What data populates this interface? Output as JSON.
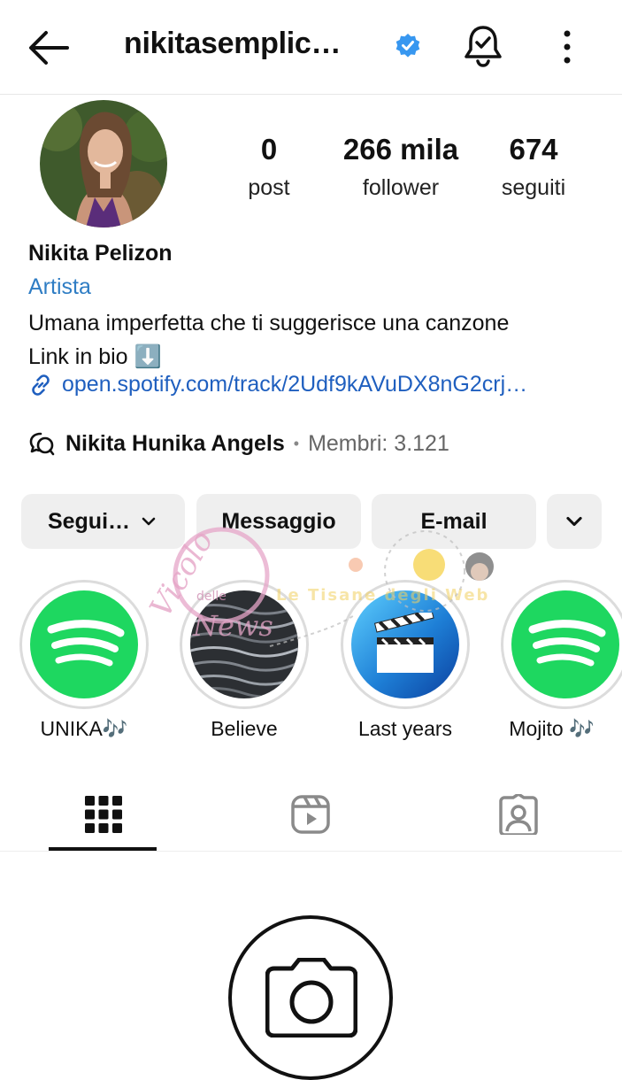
{
  "header": {
    "username": "nikitasemplic…",
    "icons": {
      "back": "back-arrow-icon",
      "verified": "verified-badge-icon",
      "notifications": "bell-check-icon",
      "more": "more-vertical-icon"
    }
  },
  "profile": {
    "stats": [
      {
        "value": "0",
        "label": "post"
      },
      {
        "value": "266 mila",
        "label": "follower"
      },
      {
        "value": "674",
        "label": "seguiti"
      }
    ],
    "name": "Nikita Pelizon",
    "category": "Artista",
    "bio_line1": "Umana imperfetta che ti suggerisce una canzone",
    "bio_line2": "Link in bio ⬇️",
    "link": "open.spotify.com/track/2Udf9kAVuDX8nG2crj…",
    "community_name": "Nikita Hunika Angels",
    "community_sep": "•",
    "community_members": "Membri: 3.121"
  },
  "actions": {
    "follow": "Segui…",
    "message": "Messaggio",
    "email": "E-mail"
  },
  "highlights": [
    {
      "label": "UNIKA🎶"
    },
    {
      "label": "Believe"
    },
    {
      "label": "Last years"
    },
    {
      "label": "Mojito 🎶"
    }
  ],
  "watermark": {
    "text1": "Vicolo",
    "text2": "delle",
    "text3": "News",
    "text4": "Le Tisane degli Web"
  },
  "colors": {
    "accent": "#2f7dc4",
    "link": "#1f5fbf",
    "verified": "#3797f0",
    "spotify": "#1ed760",
    "button_bg": "#efefef"
  }
}
